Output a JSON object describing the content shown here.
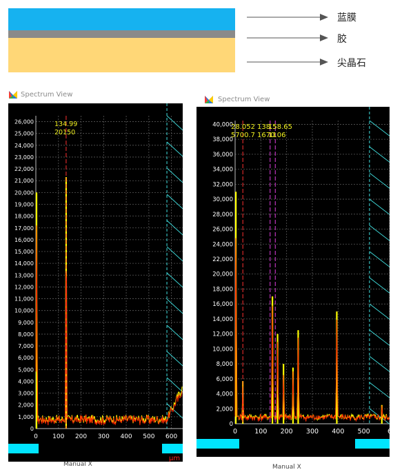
{
  "diagram": {
    "layers": [
      {
        "label": "蓝膜",
        "color": "#16b2f0"
      },
      {
        "label": "胶",
        "color": "#8a8a8a"
      },
      {
        "label": "尖晶石",
        "color": "#ffd777"
      }
    ]
  },
  "panels": [
    {
      "title": "Spectrum View",
      "x_label": "µm",
      "bottom_label": "Manual X"
    },
    {
      "title": "Spectrum View",
      "bottom_label": "Manual X"
    }
  ],
  "chart_data": [
    {
      "type": "line",
      "title": "Spectrum View",
      "xlabel": "µm",
      "xlim": [
        0,
        650
      ],
      "ylim": [
        0,
        26500
      ],
      "x_ticks": [
        0,
        100,
        200,
        300,
        400,
        500,
        600
      ],
      "y_ticks": [
        0,
        1000,
        2000,
        3000,
        4000,
        5000,
        6000,
        7000,
        8000,
        9000,
        10000,
        11000,
        12000,
        13000,
        14000,
        15000,
        16000,
        17000,
        18000,
        19000,
        20000,
        21000,
        22000,
        23000,
        24000,
        25000,
        26000
      ],
      "peaks": [
        {
          "x": 3,
          "y": 20000
        },
        {
          "x": 134,
          "y": 21300
        }
      ],
      "cursor_label": {
        "x_text": "134.99",
        "y_text": "20150"
      },
      "baseline": 800,
      "rise": {
        "start": 580,
        "end_y": 2500
      },
      "colors": {
        "fill": "#ffff00",
        "line": "#ff2200",
        "cursor": "#ff3030",
        "boundary": "#40e0e0"
      }
    },
    {
      "type": "line",
      "title": "Spectrum View",
      "xlim": [
        0,
        600
      ],
      "ylim": [
        0,
        40500
      ],
      "x_ticks": [
        0,
        100,
        200,
        300,
        400,
        500,
        600
      ],
      "x_tick_labels": [
        "0",
        "100",
        "200",
        "300",
        "400",
        "500",
        "6"
      ],
      "y_ticks": [
        0,
        2000,
        4000,
        6000,
        8000,
        10000,
        12000,
        14000,
        16000,
        18000,
        20000,
        22000,
        24000,
        26000,
        28000,
        30000,
        32000,
        34000,
        36000,
        38000,
        40000
      ],
      "peaks": [
        {
          "x": 3,
          "y": 31000
        },
        {
          "x": 30,
          "y": 5700
        },
        {
          "x": 145,
          "y": 17000
        },
        {
          "x": 165,
          "y": 12000
        },
        {
          "x": 188,
          "y": 8000
        },
        {
          "x": 225,
          "y": 7500
        },
        {
          "x": 245,
          "y": 12500
        },
        {
          "x": 395,
          "y": 15000
        },
        {
          "x": 570,
          "y": 2500
        }
      ],
      "cursor_labels": [
        {
          "x_text": "28.052",
          "y_text": "5700.7"
        },
        {
          "x_text": "138.5",
          "y_text": "1670"
        },
        {
          "x_text": "158.65",
          "y_text": "1106"
        }
      ],
      "baseline": 900,
      "colors": {
        "fill": "#ffff00",
        "line": "#ff2200",
        "cursor1": "#ff3030",
        "cursor2": "#e040e0",
        "boundary": "#40e0e0"
      }
    }
  ]
}
